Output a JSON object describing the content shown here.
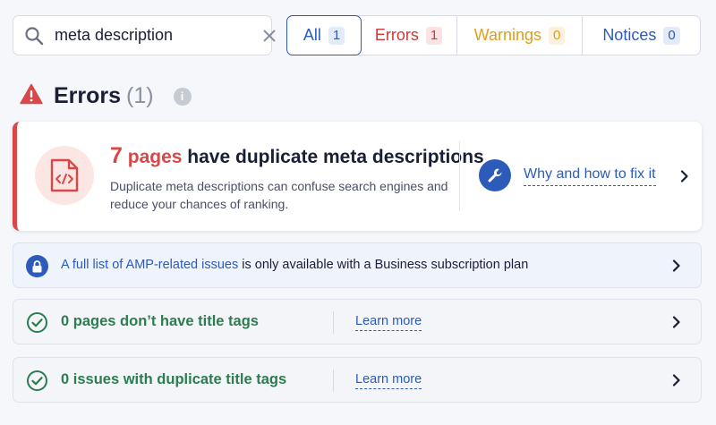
{
  "search": {
    "value": "meta description",
    "placeholder": ""
  },
  "filters": [
    {
      "label": "All",
      "count": "1"
    },
    {
      "label": "Errors",
      "count": "1"
    },
    {
      "label": "Warnings",
      "count": "0"
    },
    {
      "label": "Notices",
      "count": "0"
    }
  ],
  "section": {
    "title": "Errors",
    "count": "(1)",
    "info": "i"
  },
  "error_card": {
    "count": "7",
    "pages_word": "pages",
    "headline_rest": " have duplicate meta descriptions",
    "description": "Duplicate meta descriptions can confuse search engines and reduce your chances of ranking.",
    "fix_link": "Why and how to fix it"
  },
  "amp_row": {
    "link": "A full list of AMP-related issues",
    "text": " is only available with a Business subscription plan"
  },
  "ok_rows": [
    {
      "text": "0 pages don’t have title tags",
      "link": "Learn more"
    },
    {
      "text": "0 issues with duplicate title tags",
      "link": "Learn more"
    }
  ],
  "colors": {
    "accent": "#2d5bb9",
    "error": "#d94848",
    "warning": "#e39c17",
    "success": "#2c7d4f"
  }
}
